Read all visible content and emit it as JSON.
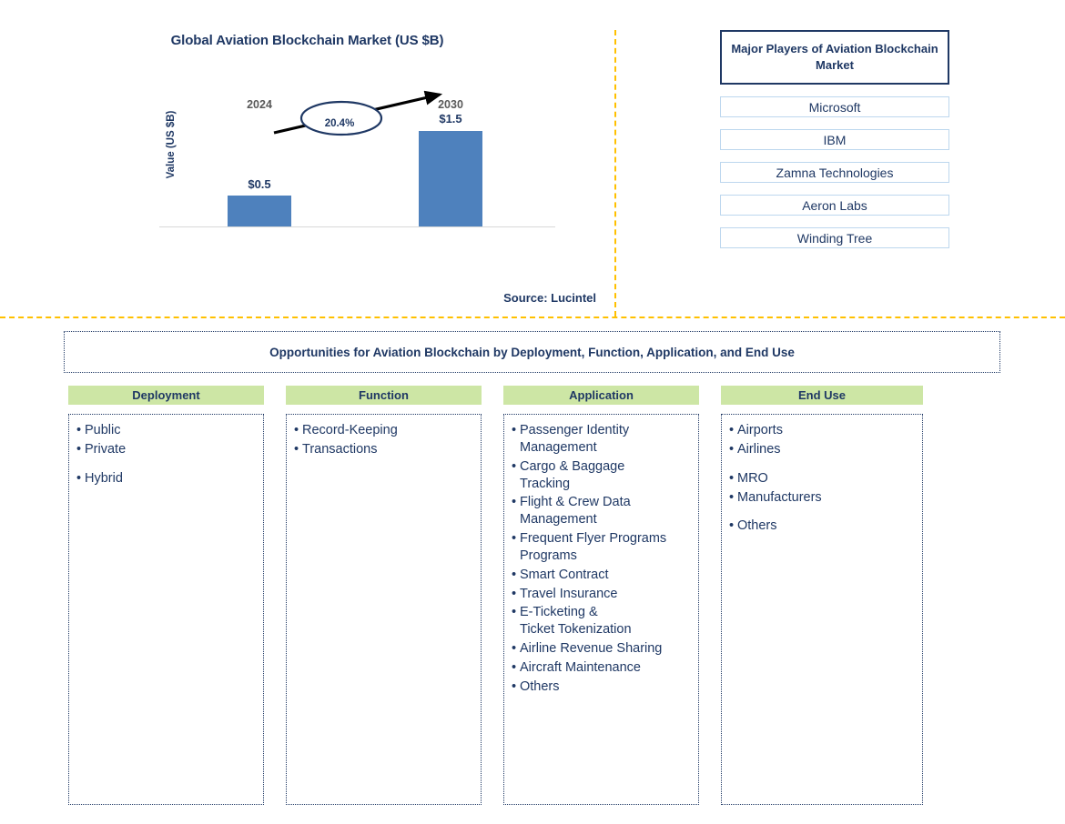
{
  "chart": {
    "title": "Global Aviation Blockchain Market (US $B)",
    "y_axis_label": "Value (US $B)",
    "cagr_label": "20.4%",
    "source": "Source: Lucintel",
    "bar_color": "#4E81BD",
    "tick_color": "#595959",
    "accent_color": "#1F3864"
  },
  "chart_data": {
    "type": "bar",
    "title": "Global Aviation Blockchain Market (US $B)",
    "xlabel": "",
    "ylabel": "Value (US $B)",
    "categories": [
      "2024",
      "2030"
    ],
    "values": [
      0.5,
      1.5
    ],
    "value_labels": [
      "$0.5",
      "$1.5"
    ],
    "ylim": [
      0,
      1.7
    ],
    "grid": false,
    "legend": "none",
    "annotations": [
      {
        "text": "20.4%",
        "type": "cagr-ellipse-arrow",
        "from": "2024",
        "to": "2030"
      }
    ],
    "source": "Source: Lucintel"
  },
  "players": {
    "header": "Major Players of Aviation Blockchain Market",
    "items": [
      "Microsoft",
      "IBM",
      "Zamna Technologies",
      "Aeron Labs",
      "Winding Tree"
    ]
  },
  "opportunities": {
    "banner": "Opportunities for Aviation Blockchain by Deployment, Function, Application, and End Use",
    "header_color": "#CDE6A5",
    "columns": [
      {
        "header": "Deployment",
        "items": [
          {
            "text": "Public",
            "gap": false
          },
          {
            "text": "Private",
            "gap": false
          },
          {
            "text": "Hybrid",
            "gap": true
          }
        ]
      },
      {
        "header": "Function",
        "items": [
          {
            "text": "Record-Keeping",
            "gap": false
          },
          {
            "text": "Transactions",
            "gap": false
          }
        ]
      },
      {
        "header": "Application",
        "items": [
          {
            "text": "Passenger Identity",
            "cont": "Management",
            "gap": false
          },
          {
            "text": "Cargo & Baggage",
            "cont": "Tracking",
            "gap": false
          },
          {
            "text": "Flight & Crew Data",
            "cont": "Management",
            "gap": false
          },
          {
            "text": "Frequent Flyer Programs",
            "cont": "Programs",
            "gap": false
          },
          {
            "text": "Smart Contract",
            "gap": false
          },
          {
            "text": "Travel Insurance",
            "gap": false
          },
          {
            "text": "E-Ticketing &",
            "cont": "Ticket Tokenization",
            "gap": false
          },
          {
            "text": "Airline Revenue Sharing",
            "gap": false
          },
          {
            "text": "Aircraft Maintenance",
            "gap": false
          },
          {
            "text": "Others",
            "gap": false
          }
        ]
      },
      {
        "header": "End Use",
        "items": [
          {
            "text": "Airports",
            "gap": false
          },
          {
            "text": "Airlines",
            "gap": false
          },
          {
            "text": "MRO",
            "gap": true
          },
          {
            "text": "Manufacturers",
            "gap": false
          },
          {
            "text": "Others",
            "gap": true
          }
        ]
      }
    ]
  }
}
